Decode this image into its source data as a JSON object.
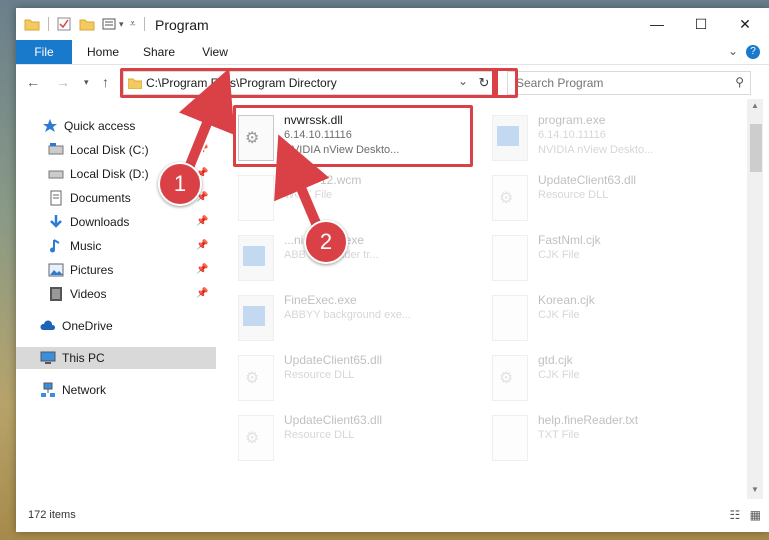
{
  "window": {
    "title": "Program",
    "controls": {
      "minimize": "—",
      "maximize": "☐",
      "close": "✕"
    }
  },
  "ribbon": {
    "tabs": [
      "File",
      "Home",
      "Share",
      "View"
    ],
    "expand_icon": "⌄",
    "help_icon": "?"
  },
  "address": {
    "path": "C:\\Program Files\\Program Directory",
    "dropdown_icon": "⌄",
    "refresh_icon": "↻"
  },
  "search": {
    "placeholder": "Search Program"
  },
  "nav": {
    "items": [
      {
        "label": "Quick access"
      },
      {
        "label": "Local Disk (C:)"
      },
      {
        "label": "Local Disk (D:)"
      },
      {
        "label": "Documents"
      },
      {
        "label": "Downloads"
      },
      {
        "label": "Music"
      },
      {
        "label": "Pictures"
      },
      {
        "label": "Videos"
      },
      {
        "label": "OneDrive"
      },
      {
        "label": "This PC"
      },
      {
        "label": "Network"
      }
    ]
  },
  "files": [
    {
      "name": "nvwrssk.dll",
      "line2": "6.14.10.11116",
      "line3": "NVIDIA nView Deskto...",
      "icon": "gear-icon"
    },
    {
      "name": "program.exe",
      "line2": "6.14.10.11116",
      "line3": "NVIDIA nView Deskto...",
      "icon": "app-icon"
    },
    {
      "name": "...oWP12.wcm",
      "line2": "WCM File",
      "line3": "",
      "icon": "file-icon"
    },
    {
      "name": "UpdateClient63.dll",
      "line2": "Resource DLL",
      "line3": "",
      "icon": "file-icon"
    },
    {
      "name": "...ninstaller.exe",
      "line2": "ABBYY...reader tr...",
      "line3": "",
      "icon": "app-icon"
    },
    {
      "name": "FastNml.cjk",
      "line2": "CJK File",
      "line3": "",
      "icon": "file-icon"
    },
    {
      "name": "FineExec.exe",
      "line2": "ABBYY background exe...",
      "line3": "",
      "icon": "app-icon"
    },
    {
      "name": "Korean.cjk",
      "line2": "CJK File",
      "line3": "",
      "icon": "file-icon"
    },
    {
      "name": "UpdateClient65.dll",
      "line2": "Resource DLL",
      "line3": "",
      "icon": "gear-icon"
    },
    {
      "name": "gtd.cjk",
      "line2": "CJK File",
      "line3": "",
      "icon": "gear-icon"
    },
    {
      "name": "UpdateClient63.dll",
      "line2": "Resource DLL",
      "line3": "",
      "icon": "gear-icon"
    },
    {
      "name": "help.fineReader.txt",
      "line2": "TXT File",
      "line3": "",
      "icon": "file-icon"
    }
  ],
  "status": {
    "count": "172 items"
  },
  "callouts": [
    "1",
    "2"
  ],
  "colors": {
    "accent": "#1979ca",
    "highlight": "#d94147",
    "selected": "#d9d9d9"
  }
}
